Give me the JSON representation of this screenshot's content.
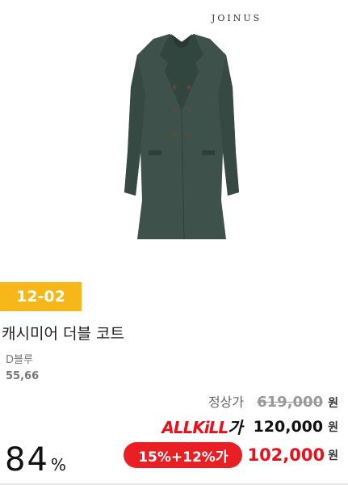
{
  "product": {
    "brand": "JOINUS",
    "image_icon": "double-coat-image",
    "date_badge": "12-02",
    "title": "캐시미어 더블 코트",
    "color_option": "D블루",
    "size_option": "55,66"
  },
  "pricing": {
    "regular_label": "정상가",
    "regular_price": "619,000",
    "allkill_logo_prefix": "ALL",
    "allkill_logo_mid": "KiLL",
    "allkill_logo_suffix": "가",
    "allkill_price": "120,000",
    "coupon_label": "15%+12%가",
    "final_price": "102,000",
    "currency": "원",
    "discount_rate": "84",
    "discount_unit": "%"
  },
  "colors": {
    "badge_yellow": "#f7b719",
    "accent_red": "#e8111b",
    "coat_green": "#3e524b"
  }
}
